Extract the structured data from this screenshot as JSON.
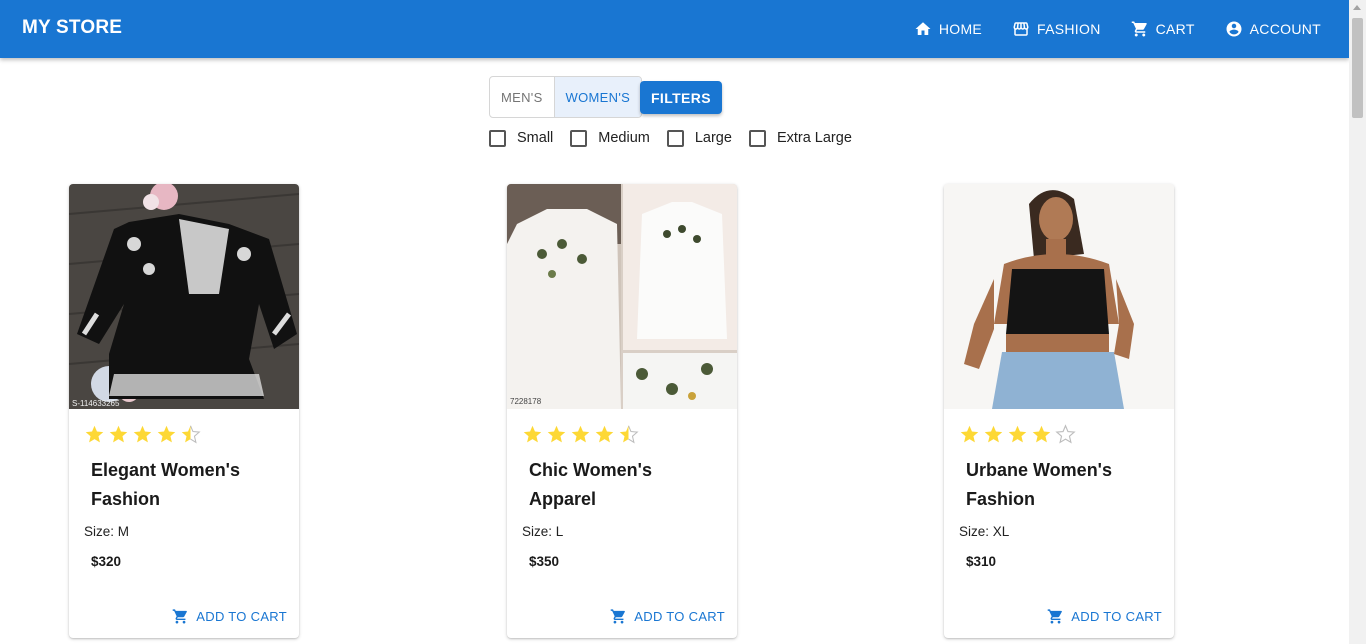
{
  "app": {
    "brand": "MY STORE"
  },
  "nav": [
    {
      "label": "HOME",
      "icon": "home-icon"
    },
    {
      "label": "FASHION",
      "icon": "store-icon"
    },
    {
      "label": "CART",
      "icon": "cart-icon"
    },
    {
      "label": "ACCOUNT",
      "icon": "account-circle-icon"
    }
  ],
  "gender_toggle": {
    "options": [
      "MEN'S",
      "WOMEN'S"
    ],
    "selected": "WOMEN'S"
  },
  "filters_button": "FILTERS",
  "size_filters": [
    {
      "label": "Small",
      "checked": false
    },
    {
      "label": "Medium",
      "checked": false
    },
    {
      "label": "Large",
      "checked": false
    },
    {
      "label": "Extra Large",
      "checked": false
    }
  ],
  "products": [
    {
      "title": "Elegant Women's Fashion",
      "rating": 4.5,
      "size": "Size: M",
      "price": "$320",
      "add_to_cart": "ADD TO CART",
      "image_watermark": "S-114633265"
    },
    {
      "title": "Chic Women's Apparel",
      "rating": 4.5,
      "size": "Size: L",
      "price": "$350",
      "add_to_cart": "ADD TO CART",
      "image_watermark": "7228178"
    },
    {
      "title": "Urbane Women's Fashion",
      "rating": 4,
      "size": "Size: XL",
      "price": "$310",
      "add_to_cart": "ADD TO CART",
      "image_watermark": ""
    }
  ],
  "colors": {
    "primary": "#1976d2",
    "star": "#fdd835",
    "star_empty": "#bdbdbd"
  }
}
